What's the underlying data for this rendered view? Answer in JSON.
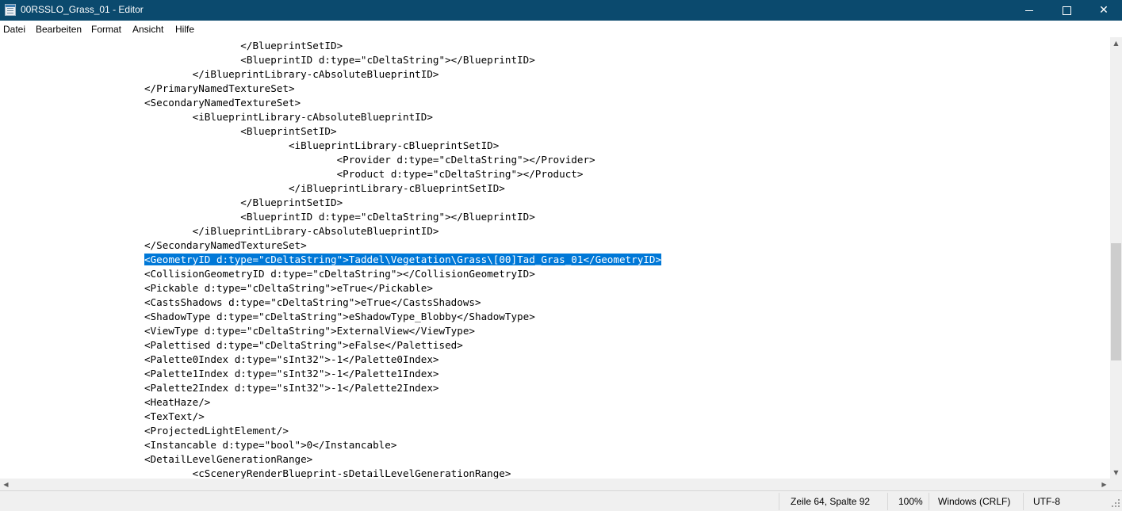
{
  "window": {
    "title": "00RSSLO_Grass_01 - Editor",
    "icon": "notepad-icon",
    "buttons": {
      "minimize": "minimize-icon",
      "maximize": "maximize-icon",
      "close": "✕"
    }
  },
  "menu": [
    "Datei",
    "Bearbeiten",
    "Format",
    "Ansicht",
    "Hilfe"
  ],
  "editor": {
    "lines": [
      {
        "text": "\t\t\t\t\t</BlueprintSetID>"
      },
      {
        "text": "\t\t\t\t\t<BlueprintID d:type=\"cDeltaString\"></BlueprintID>"
      },
      {
        "text": "\t\t\t\t</iBlueprintLibrary-cAbsoluteBlueprintID>"
      },
      {
        "text": "\t\t\t</PrimaryNamedTextureSet>"
      },
      {
        "text": "\t\t\t<SecondaryNamedTextureSet>"
      },
      {
        "text": "\t\t\t\t<iBlueprintLibrary-cAbsoluteBlueprintID>"
      },
      {
        "text": "\t\t\t\t\t<BlueprintSetID>"
      },
      {
        "text": "\t\t\t\t\t\t<iBlueprintLibrary-cBlueprintSetID>"
      },
      {
        "text": "\t\t\t\t\t\t\t<Provider d:type=\"cDeltaString\"></Provider>"
      },
      {
        "text": "\t\t\t\t\t\t\t<Product d:type=\"cDeltaString\"></Product>"
      },
      {
        "text": "\t\t\t\t\t\t</iBlueprintLibrary-cBlueprintSetID>"
      },
      {
        "text": "\t\t\t\t\t</BlueprintSetID>"
      },
      {
        "text": "\t\t\t\t\t<BlueprintID d:type=\"cDeltaString\"></BlueprintID>"
      },
      {
        "text": "\t\t\t\t</iBlueprintLibrary-cAbsoluteBlueprintID>"
      },
      {
        "text": "\t\t\t</SecondaryNamedTextureSet>"
      },
      {
        "indent": "\t\t\t",
        "selected": "<GeometryID d:type=\"cDeltaString\">Taddel\\Vegetation\\Grass\\[00]Tad_Gras_01</GeometryID>"
      },
      {
        "text": "\t\t\t<CollisionGeometryID d:type=\"cDeltaString\"></CollisionGeometryID>"
      },
      {
        "text": "\t\t\t<Pickable d:type=\"cDeltaString\">eTrue</Pickable>"
      },
      {
        "text": "\t\t\t<CastsShadows d:type=\"cDeltaString\">eTrue</CastsShadows>"
      },
      {
        "text": "\t\t\t<ShadowType d:type=\"cDeltaString\">eShadowType_Blobby</ShadowType>"
      },
      {
        "text": "\t\t\t<ViewType d:type=\"cDeltaString\">ExternalView</ViewType>"
      },
      {
        "text": "\t\t\t<Palettised d:type=\"cDeltaString\">eFalse</Palettised>"
      },
      {
        "text": "\t\t\t<Palette0Index d:type=\"sInt32\">-1</Palette0Index>"
      },
      {
        "text": "\t\t\t<Palette1Index d:type=\"sInt32\">-1</Palette1Index>"
      },
      {
        "text": "\t\t\t<Palette2Index d:type=\"sInt32\">-1</Palette2Index>"
      },
      {
        "text": "\t\t\t<HeatHaze/>"
      },
      {
        "text": "\t\t\t<TexText/>"
      },
      {
        "text": "\t\t\t<ProjectedLightElement/>"
      },
      {
        "text": "\t\t\t<Instancable d:type=\"bool\">0</Instancable>"
      },
      {
        "text": "\t\t\t<DetailLevelGenerationRange>"
      },
      {
        "text": "\t\t\t\t<cSceneryRenderBlueprint-sDetailLevelGenerationRange>"
      }
    ],
    "selection_color": "#0078d7"
  },
  "status": {
    "position": "Zeile 64, Spalte 92",
    "zoom": "100%",
    "line_ending": "Windows (CRLF)",
    "encoding": "UTF-8"
  },
  "colors": {
    "titlebar": "#0b4a6e",
    "selection": "#0078d7",
    "statusbar": "#f0f0f0"
  }
}
